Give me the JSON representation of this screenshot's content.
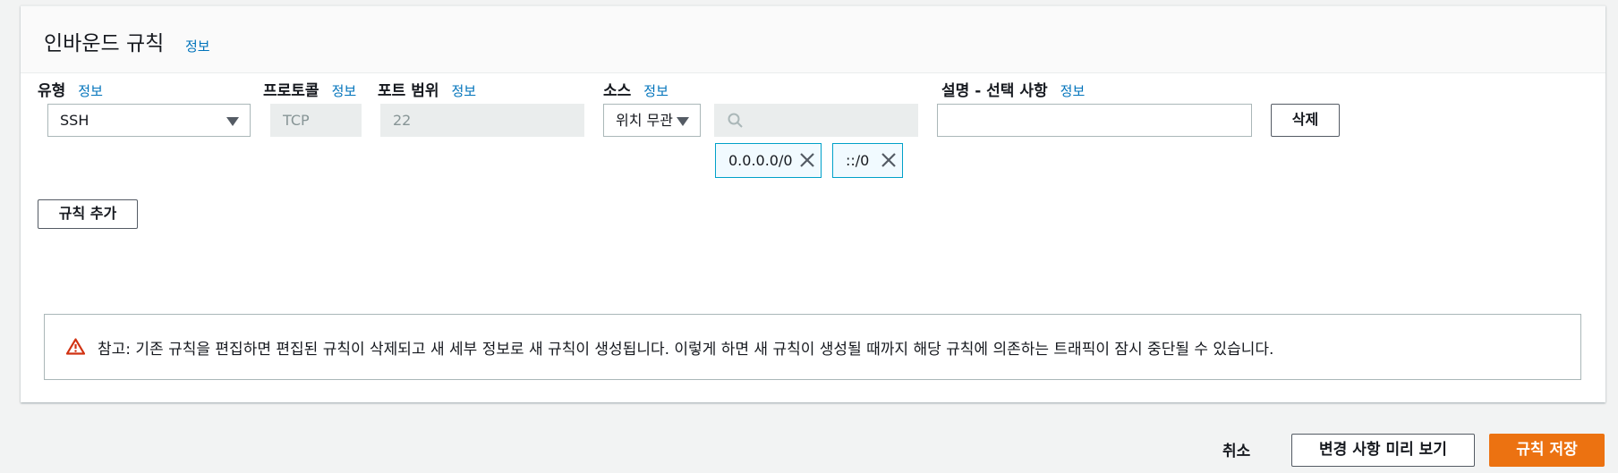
{
  "header": {
    "title": "인바운드 규칙",
    "info": "정보"
  },
  "columns": {
    "type": {
      "label": "유형",
      "info": "정보"
    },
    "protocol": {
      "label": "프로토콜",
      "info": "정보"
    },
    "port_range": {
      "label": "포트 범위",
      "info": "정보"
    },
    "source": {
      "label": "소스",
      "info": "정보"
    },
    "description": {
      "label": "설명 - 선택 사항",
      "info": "정보"
    }
  },
  "rule": {
    "type_value": "SSH",
    "protocol_value": "TCP",
    "port_value": "22",
    "source_value": "위치 무관",
    "search_value": "",
    "description_value": "",
    "delete_label": "삭제",
    "tokens": [
      "0.0.0.0/0",
      "::/0"
    ]
  },
  "add_rule_label": "규칙 추가",
  "alert": {
    "text": "참고: 기존 규칙을 편집하면 편집된 규칙이 삭제되고 새 세부 정보로 새 규칙이 생성됩니다. 이렇게 하면 새 규칙이 생성될 때까지 해당 규칙에 의존하는 트래픽이 잠시 중단될 수 있습니다.",
    "icon": "warning-icon"
  },
  "footer": {
    "cancel_label": "취소",
    "preview_label": "변경 사항 미리 보기",
    "save_label": "규칙 저장"
  },
  "colors": {
    "accent": "#ec7211",
    "link": "#0073bb",
    "warning": "#d13212",
    "token_border": "#00a1c9"
  }
}
